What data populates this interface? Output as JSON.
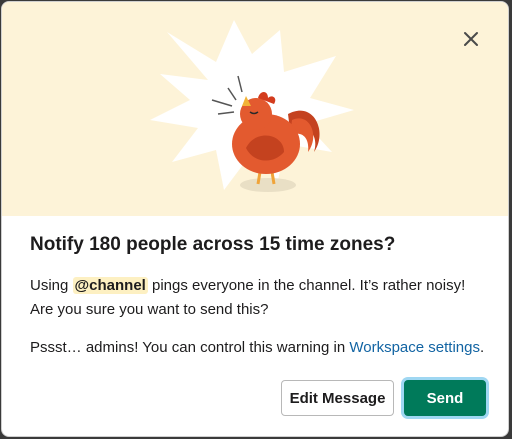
{
  "dialog": {
    "title": "Notify 180 people across 15 time zones?",
    "body_prefix": "Using ",
    "mention": "@channel",
    "body_suffix": " pings everyone in the channel. It’s rather noisy! Are you sure you want to send this?",
    "admin_text": "Pssst… admins! You can control this warning in ",
    "admin_link": "Workspace settings",
    "admin_end": ".",
    "edit_label": "Edit Message",
    "send_label": "Send"
  },
  "icons": {
    "close": "close-icon",
    "illustration": "rooster-illustration"
  },
  "colors": {
    "hero_bg": "#fdf3d8",
    "mention_bg": "#fdf0c2",
    "link": "#1264a3",
    "send_bg": "#007a5a"
  }
}
